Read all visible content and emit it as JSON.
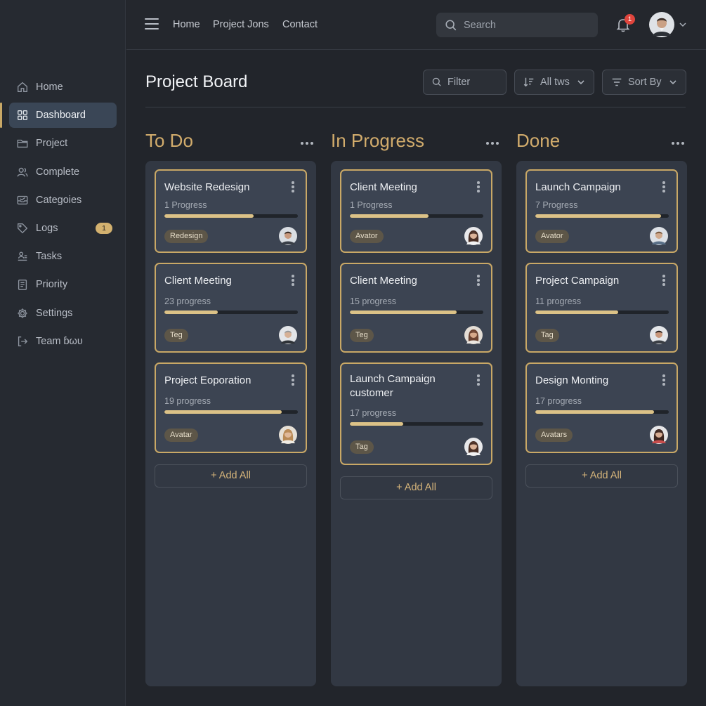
{
  "sidebar": {
    "items": [
      {
        "label": "Home",
        "icon": "home-icon"
      },
      {
        "label": "Dashboard",
        "icon": "grid-icon",
        "active": true
      },
      {
        "label": "Project",
        "icon": "folder-icon"
      },
      {
        "label": "Complete",
        "icon": "users-icon"
      },
      {
        "label": "Categoies",
        "icon": "inbox-icon"
      },
      {
        "label": "Logs",
        "icon": "tag-icon",
        "badge": "1"
      },
      {
        "label": "Tasks",
        "icon": "tasks-icon"
      },
      {
        "label": "Priority",
        "icon": "clipboard-icon"
      },
      {
        "label": "Settings",
        "icon": "gear-icon"
      },
      {
        "label": "Team ɓωυ",
        "icon": "logout-icon"
      }
    ]
  },
  "topbar": {
    "links": [
      "Home",
      "Project Jons",
      "Contact"
    ],
    "search_placeholder": "Search",
    "notification_count": "1"
  },
  "header": {
    "title": "Project Board",
    "filter_placeholder": "Filter",
    "all_label": "All tws",
    "sort_label": "Sort Βy"
  },
  "columns": [
    {
      "title": "To Do",
      "add_label": "+ Add All",
      "cards": [
        {
          "title": "Website Redesign",
          "sub": "1 Progress",
          "progress": 0.67,
          "tag": "Redesign",
          "avatar": "man-1"
        },
        {
          "title": "Client Meeting",
          "sub": "23 progress",
          "progress": 0.4,
          "tag": "Teg",
          "avatar": "man-2"
        },
        {
          "title": "Project Eoporation",
          "sub": "19 progress",
          "progress": 0.88,
          "tag": "Avatar",
          "avatar": "woman-1"
        }
      ]
    },
    {
      "title": "In Progress",
      "add_label": "+ Add All",
      "cards": [
        {
          "title": "Client Meeting",
          "sub": "1 Progress",
          "progress": 0.59,
          "tag": "Avator",
          "avatar": "woman-2"
        },
        {
          "title": "Client Meeting",
          "sub": "15 progress",
          "progress": 0.8,
          "tag": "Teg",
          "avatar": "woman-3"
        },
        {
          "title": "Launch Campaign customer",
          "sub": "17 progress",
          "progress": 0.4,
          "tag": "Tag",
          "avatar": "woman-2"
        }
      ]
    },
    {
      "title": "Done",
      "add_label": "+ Add All",
      "cards": [
        {
          "title": "Launch Campaign",
          "sub": "7 Progress",
          "progress": 0.94,
          "tag": "Avator",
          "avatar": "man-3"
        },
        {
          "title": "Project Campaign",
          "sub": "11 progress",
          "progress": 0.62,
          "tag": "Tag",
          "avatar": "man-4"
        },
        {
          "title": "Design Monting",
          "sub": "17 progress",
          "progress": 0.89,
          "tag": "Avatars",
          "avatar": "woman-4"
        }
      ]
    }
  ],
  "colors": {
    "accent": "#c9a866",
    "progress": "#dcc287",
    "badge": "#d3b16f",
    "notification": "#e0453d"
  }
}
